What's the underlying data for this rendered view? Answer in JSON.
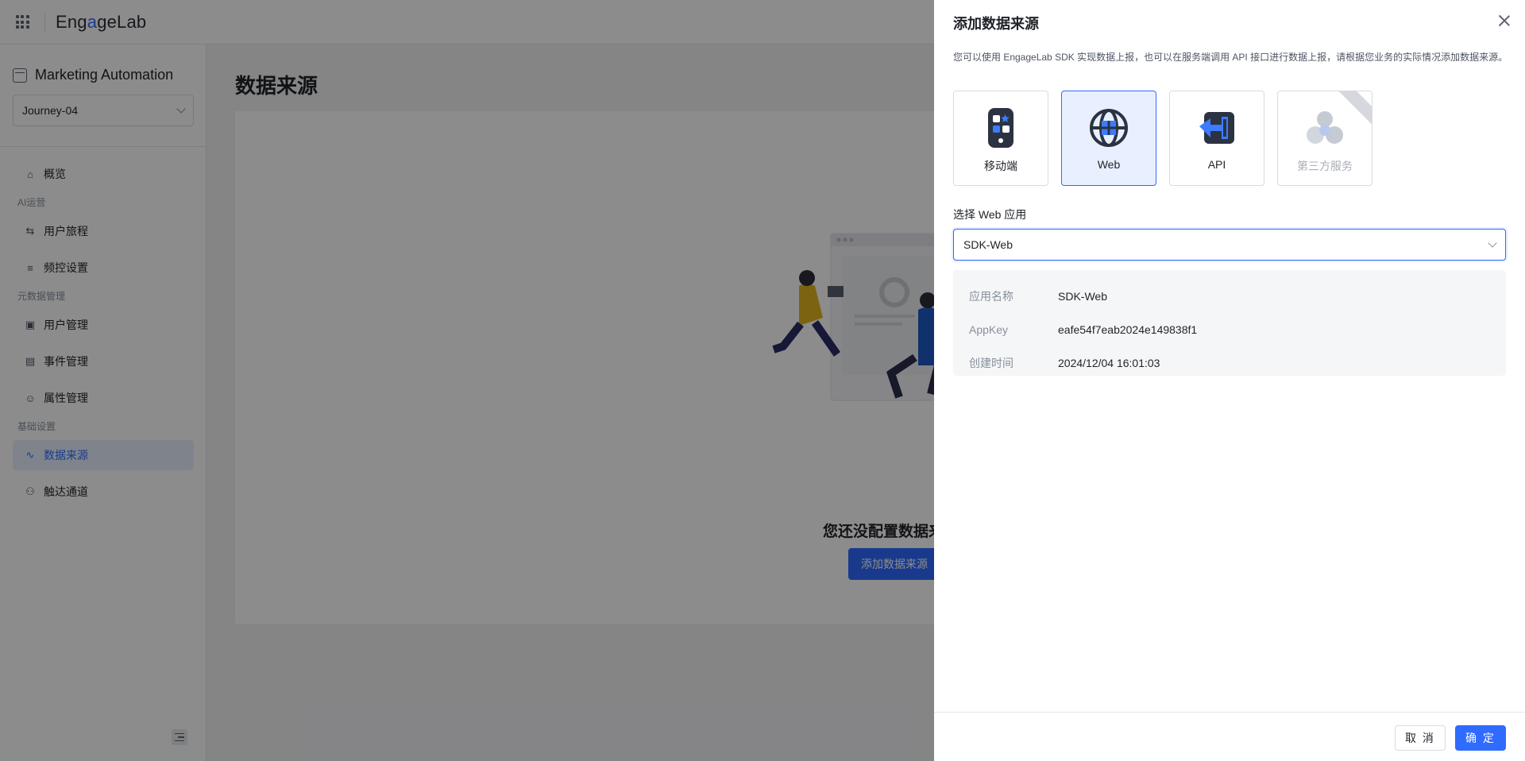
{
  "topbar": {
    "logo_pre": "Eng",
    "logo_accent": "a",
    "logo_post": "geLab"
  },
  "sidebar": {
    "product_title": "Marketing Automation",
    "journey_value": "Journey-04",
    "items": [
      {
        "type": "item",
        "label": "概览",
        "icon": "home-icon"
      },
      {
        "type": "group",
        "label": "AI运营"
      },
      {
        "type": "item",
        "label": "用户旅程",
        "icon": "journey-icon"
      },
      {
        "type": "item",
        "label": "频控设置",
        "icon": "frequency-icon"
      },
      {
        "type": "group",
        "label": "元数据管理"
      },
      {
        "type": "item",
        "label": "用户管理",
        "icon": "user-image-icon"
      },
      {
        "type": "item",
        "label": "事件管理",
        "icon": "clipboard-icon"
      },
      {
        "type": "item",
        "label": "属性管理",
        "icon": "person-icon"
      },
      {
        "type": "group",
        "label": "基础设置"
      },
      {
        "type": "item",
        "label": "数据来源",
        "icon": "chart-line-icon",
        "active": true
      },
      {
        "type": "item",
        "label": "触达通道",
        "icon": "channel-icon"
      }
    ]
  },
  "main": {
    "page_title": "数据来源",
    "empty_text": "您还没配置数据来源",
    "add_button": "添加数据来源"
  },
  "drawer": {
    "title": "添加数据来源",
    "description": "您可以使用 EngageLab SDK 实现数据上报，也可以在服务端调用 API 接口进行数据上报，请根据您业务的实际情况添加数据来源。",
    "types": [
      {
        "label": "移动端",
        "icon": "mobile-icon",
        "selected": false,
        "disabled": false
      },
      {
        "label": "Web",
        "icon": "globe-icon",
        "selected": true,
        "disabled": false
      },
      {
        "label": "API",
        "icon": "api-icon",
        "selected": false,
        "disabled": false
      },
      {
        "label": "第三方服务",
        "icon": "third-party-icon",
        "selected": false,
        "disabled": true
      }
    ],
    "select_label": "选择 Web 应用",
    "select_value": "SDK-Web",
    "info": [
      {
        "key": "应用名称",
        "value": "SDK-Web"
      },
      {
        "key": "AppKey",
        "value": "eafe54f7eab2024e149838f1"
      },
      {
        "key": "创建时间",
        "value": "2024/12/04 16:01:03"
      }
    ],
    "cancel_label": "取 消",
    "ok_label": "确 定"
  },
  "colors": {
    "accent": "#2f6bff",
    "overlay": "rgba(0,0,0,0.45)",
    "selected_bg": "#e8f0ff"
  }
}
